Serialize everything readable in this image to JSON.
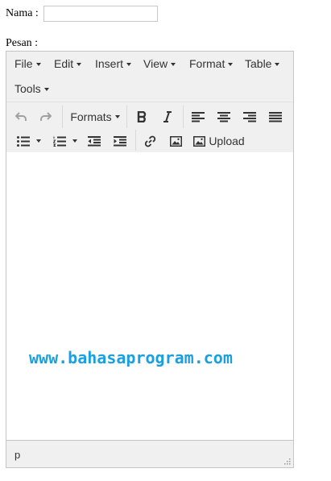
{
  "form": {
    "name_label": "Nama :",
    "name_value": "",
    "message_label": "Pesan :"
  },
  "menubar": [
    "File",
    "Edit",
    "Insert",
    "View",
    "Format",
    "Table",
    "Tools"
  ],
  "toolbar": {
    "formats_label": "Formats",
    "upload_label": "Upload"
  },
  "content": {
    "watermark": "www.bahasaprogram.com"
  },
  "statusbar": {
    "path": "p"
  },
  "colors": {
    "watermark": "#1aa0e0",
    "chrome_bg": "#f0f0f0",
    "border": "#c5c5c5"
  }
}
